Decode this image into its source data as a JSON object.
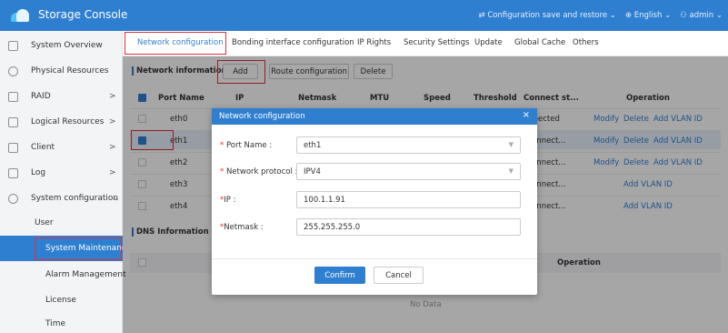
{
  "app": {
    "title": "Storage Console"
  },
  "topbar": {
    "config_save": "⇄ Configuration save and restore ⌄",
    "language": "⊕ English ⌄",
    "user": "⚇ admin ⌄"
  },
  "sidebar": {
    "items": [
      {
        "label": "System Overview",
        "icon": "overview-icon"
      },
      {
        "label": "Physical Resources",
        "icon": "physical-icon"
      },
      {
        "label": "RAID",
        "icon": "raid-icon",
        "arrow": ">"
      },
      {
        "label": "Logical Resources",
        "icon": "logical-icon",
        "arrow": ">"
      },
      {
        "label": "Client",
        "icon": "client-icon",
        "arrow": ">"
      },
      {
        "label": "Log",
        "icon": "log-icon",
        "arrow": ">"
      },
      {
        "label": "System configuration",
        "icon": "gear-icon",
        "arrow": "⌄"
      }
    ],
    "subitems": [
      {
        "label": "User"
      },
      {
        "label": "System Maintenance",
        "active": true
      },
      {
        "label": "Alarm Management"
      },
      {
        "label": "License"
      },
      {
        "label": "Time"
      }
    ]
  },
  "tabs": [
    {
      "label": "Network configuration",
      "active": true
    },
    {
      "label": "Bonding interface configuration"
    },
    {
      "label": "IP Rights"
    },
    {
      "label": "Security Settings"
    },
    {
      "label": "Update"
    },
    {
      "label": "Global Cache"
    },
    {
      "label": "Others"
    }
  ],
  "network": {
    "section_title": "Network information",
    "buttons": {
      "add": "Add",
      "route": "Route configuration",
      "delete": "Delete"
    },
    "columns": [
      "Port Name",
      "IP",
      "Netmask",
      "MTU",
      "Speed",
      "Threshold",
      "Connect st...",
      "Operation"
    ],
    "rows": [
      {
        "port": "eth0",
        "status": "onnected",
        "ops": [
          "Modify",
          "Delete",
          "Add VLAN ID"
        ],
        "checked": false
      },
      {
        "port": "eth1",
        "status": "sconnect...",
        "ops": [
          "Modify",
          "Delete",
          "Add VLAN ID"
        ],
        "checked": true
      },
      {
        "port": "eth2",
        "status": "sconnect...",
        "ops": [
          "Modify",
          "Delete",
          "Add VLAN ID"
        ],
        "checked": false
      },
      {
        "port": "eth3",
        "status": "sconnect...",
        "ops": [
          "Add VLAN ID"
        ],
        "checked": false
      },
      {
        "port": "eth4",
        "status": "sconnect...",
        "ops": [
          "Add VLAN ID"
        ],
        "checked": false
      }
    ]
  },
  "dns": {
    "section_title": "DNS Information",
    "operation_header": "Operation",
    "empty_text": "No Data"
  },
  "modal": {
    "title": "Network configuration",
    "close": "×",
    "fields": {
      "port_name": {
        "label": "Port Name :",
        "value": "eth1"
      },
      "protocol": {
        "label": "Network protocol :",
        "value": "IPV4"
      },
      "ip": {
        "label": "IP :",
        "value": "100.1.1.91"
      },
      "netmask": {
        "label": "Netmask :",
        "value": "255.255.255.0"
      }
    },
    "required_mark": "*",
    "confirm": "Confirm",
    "cancel": "Cancel"
  },
  "colors": {
    "primary": "#2f7fd1",
    "highlight": "#e0303a",
    "sidebar_bg": "#f3f4f6"
  }
}
